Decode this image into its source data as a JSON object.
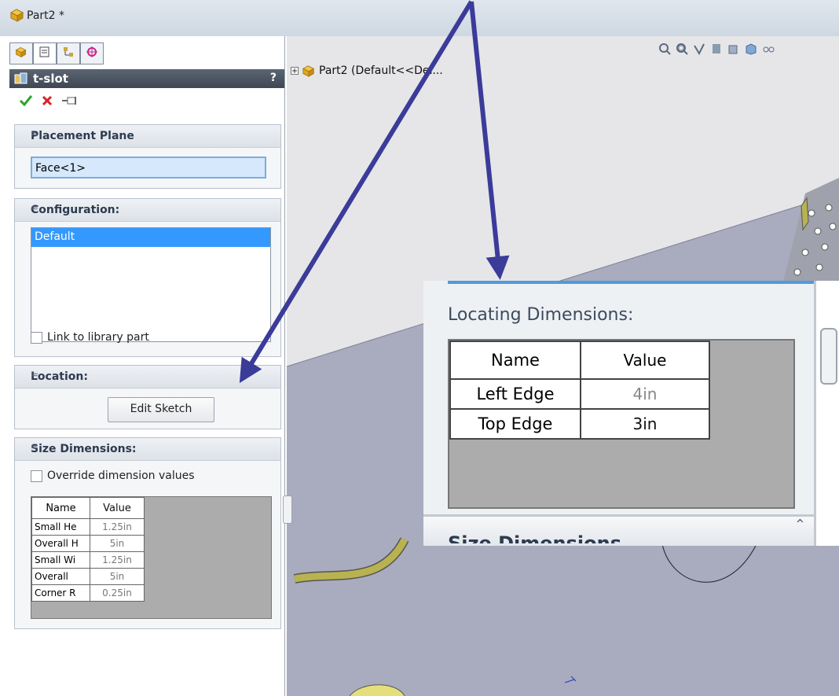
{
  "window": {
    "title": "Part2 *"
  },
  "feature": {
    "name": "t-slot",
    "help_label": "?"
  },
  "placement": {
    "header": "Placement Plane",
    "value": "Face<1>"
  },
  "configuration": {
    "header": "Configuration:",
    "items": [
      "Default"
    ],
    "link_label": "Link to library part"
  },
  "location": {
    "header": "Location:",
    "edit_button": "Edit Sketch"
  },
  "size": {
    "header": "Size Dimensions:",
    "override_label": "Override dimension values",
    "columns": [
      "Name",
      "Value"
    ],
    "rows": [
      {
        "name": "Small He",
        "value": "1.25in"
      },
      {
        "name": "Overall H",
        "value": "5in"
      },
      {
        "name": "Small Wi",
        "value": "1.25in"
      },
      {
        "name": "Overall",
        "value": "5in"
      },
      {
        "name": "Corner R",
        "value": "0.25in"
      }
    ]
  },
  "tree": {
    "item": "Part2  (Default<<Def..."
  },
  "zoom": {
    "label": "Locating Dimensions:",
    "columns": [
      "Name",
      "Value"
    ],
    "rows": [
      {
        "name": "Left Edge",
        "value": "4in"
      },
      {
        "name": "Top Edge",
        "value": "3in"
      }
    ],
    "next_header": "Size Dimensions"
  },
  "colors": {
    "accent": "#3399ff",
    "arrow": "#3b3b9a",
    "part_yellow": "#b8b350",
    "viewport": "#a9abbe"
  },
  "icons": [
    "part-icon",
    "feature-manager-icon",
    "property-manager-icon",
    "config-manager-icon",
    "dim-expert-icon",
    "ok-check-icon",
    "cancel-x-icon",
    "pushpin-icon",
    "collapse-icon"
  ]
}
